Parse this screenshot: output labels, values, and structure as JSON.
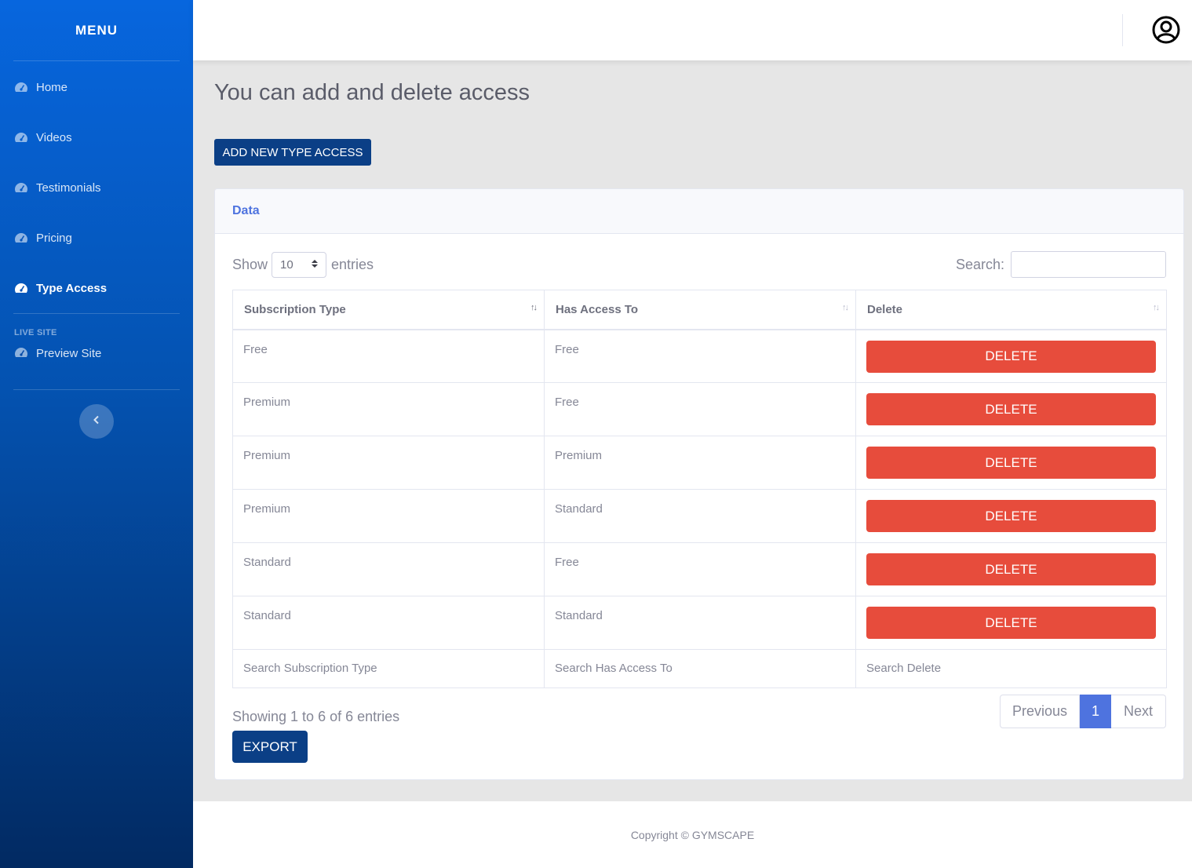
{
  "sidebar": {
    "brand": "MENU",
    "items": [
      {
        "label": "Home",
        "icon": "tachometer-icon"
      },
      {
        "label": "Videos",
        "icon": "tachometer-icon"
      },
      {
        "label": "Testimonials",
        "icon": "tachometer-icon"
      },
      {
        "label": "Pricing",
        "icon": "tachometer-icon"
      },
      {
        "label": "Type Access",
        "icon": "tachometer-icon",
        "active": true
      }
    ],
    "section_heading": "LIVE SITE",
    "preview_label": "Preview Site",
    "toggle_icon": "chevron-left-icon"
  },
  "topbar": {
    "user_icon": "user-circle-icon"
  },
  "main": {
    "title": "You can add and delete access",
    "add_button": "ADD NEW TYPE ACCESS",
    "card_title": "Data",
    "show_label": "Show",
    "entries_value": "10",
    "entries_label": "entries",
    "search_label": "Search:",
    "columns": [
      "Subscription Type",
      "Has Access To",
      "Delete"
    ],
    "rows": [
      {
        "type": "Free",
        "access": "Free",
        "action": "DELETE"
      },
      {
        "type": "Premium",
        "access": "Free",
        "action": "DELETE"
      },
      {
        "type": "Premium",
        "access": "Premium",
        "action": "DELETE"
      },
      {
        "type": "Premium",
        "access": "Standard",
        "action": "DELETE"
      },
      {
        "type": "Standard",
        "access": "Free",
        "action": "DELETE"
      },
      {
        "type": "Standard",
        "access": "Standard",
        "action": "DELETE"
      }
    ],
    "footer_search": [
      "Search Subscription Type",
      "Search Has Access To",
      "Search Delete"
    ],
    "info": "Showing 1 to 6 of 6 entries",
    "export_button": "EXPORT",
    "pagination": {
      "previous": "Previous",
      "current": "1",
      "next": "Next"
    }
  },
  "footer": {
    "copyright": "Copyright © GYMSCAPE"
  },
  "colors": {
    "primary": "#0b3f86",
    "danger": "#e74c3c",
    "accent": "#4e73df",
    "sidebar_top": "#0766de",
    "sidebar_bottom": "#022a62"
  }
}
